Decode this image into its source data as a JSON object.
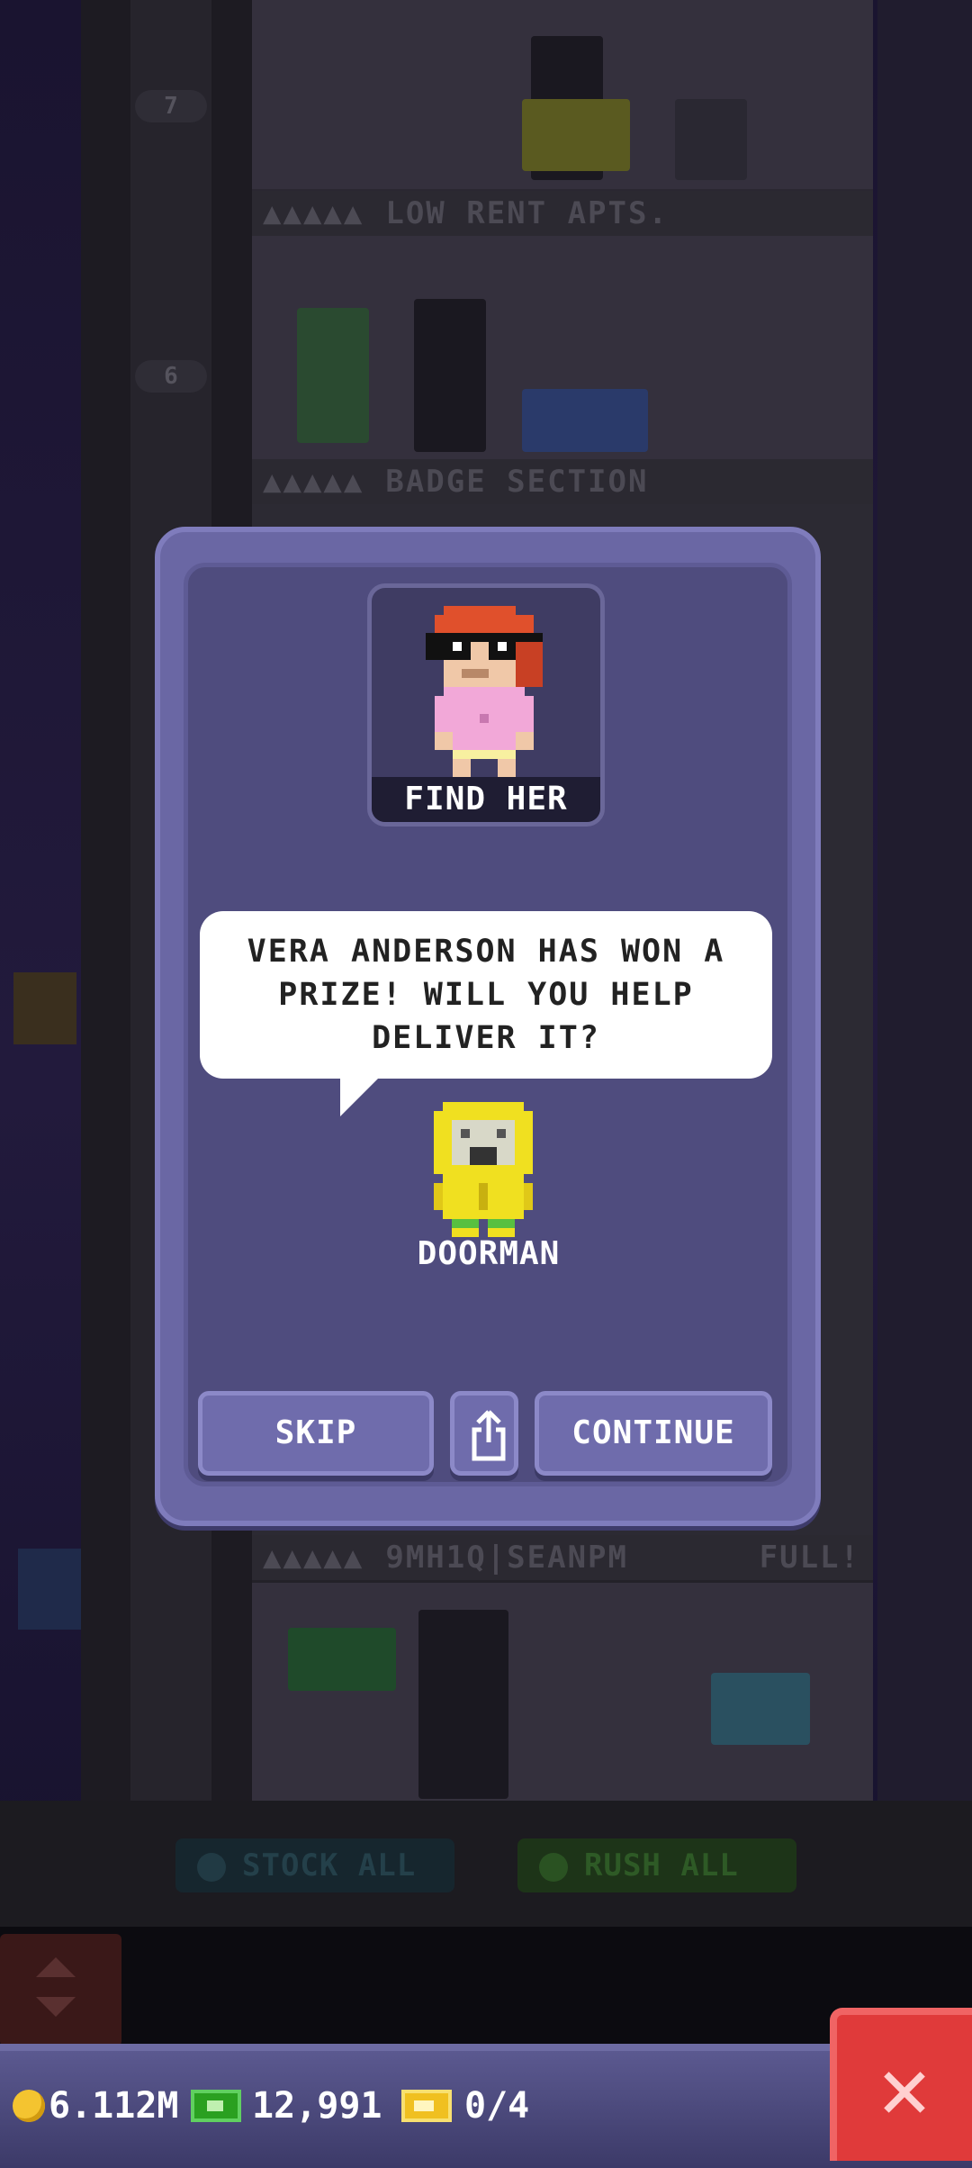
{
  "background": {
    "floor_numbers": [
      "7",
      "6"
    ],
    "floor_signs": [
      {
        "dots": "▲▲▲▲▲",
        "name": "LOW RENT APTS.",
        "status": ""
      },
      {
        "dots": "▲▲▲▲▲",
        "name": "BADGE SECTION",
        "status": ""
      },
      {
        "dots": "▲▲▲▲▲",
        "name": "9MH1Q|SEANPM",
        "status": "FULL!"
      }
    ],
    "actions": {
      "stock_all": "STOCK ALL",
      "rush_all": "RUSH ALL"
    }
  },
  "modal": {
    "portrait_label": "FIND HER",
    "speech": "VERA ANDERSON HAS WON A PRIZE! WILL YOU HELP DELIVER IT?",
    "speaker_name": "DOORMAN",
    "buttons": {
      "skip": "SKIP",
      "continue": "CONTINUE"
    }
  },
  "status_bar": {
    "coins": "6.112M",
    "bux": "12,991",
    "tickets": "0/4"
  },
  "colors": {
    "modal": "#4f4c7e",
    "close": "#e03a3a",
    "coin": "#f4c430",
    "bux": "#2aa020"
  },
  "icons": [
    "coin-icon",
    "bux-icon",
    "ticket-icon",
    "share-icon",
    "close-icon",
    "elevator-arrows-icon"
  ]
}
